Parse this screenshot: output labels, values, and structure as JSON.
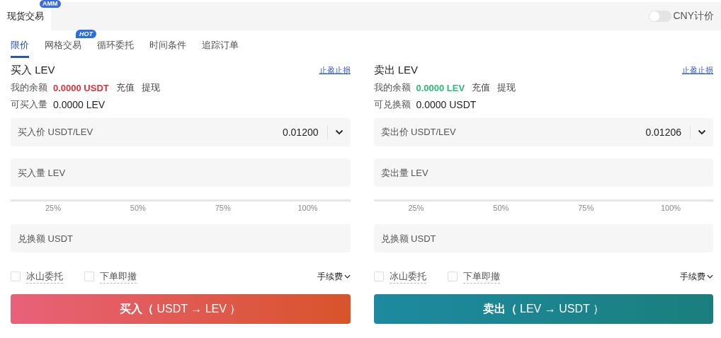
{
  "top_tabs": [
    {
      "label": "现货交易",
      "selected": true,
      "badge": "AMM"
    }
  ],
  "cny_toggle": {
    "label": "CNY计价",
    "on": false
  },
  "order_tabs": [
    {
      "label": "限价",
      "selected": true
    },
    {
      "label": "网格交易",
      "selected": false,
      "badge": "HOT"
    },
    {
      "label": "循环委托",
      "selected": false
    },
    {
      "label": "时间条件",
      "selected": false
    },
    {
      "label": "追踪订单",
      "selected": false
    }
  ],
  "panels": [
    {
      "kind": "buy",
      "title": "买入 LEV",
      "stop_link": "止盈止损",
      "balance_label": "我的余额",
      "balance_value": "0.0000 USDT",
      "deposit": "充值",
      "withdraw": "提现",
      "available_label": "可买入量",
      "available_value": "0.0000 LEV",
      "price_placeholder": "买入价 USDT/LEV",
      "price_value": "0.01200",
      "amount_placeholder": "买入量 LEV",
      "level": 0,
      "ticks": [
        "25%",
        "50%",
        "75%",
        "100%"
      ],
      "total_placeholder": "兑换额 USDT",
      "options": [
        {
          "label": "冰山委托",
          "checked": false
        },
        {
          "label": "下单即撤",
          "checked": false
        }
      ],
      "fee": "手续费",
      "button": "**买入（** USDT → LEV ）"
    },
    {
      "kind": "sell",
      "title": "卖出 LEV",
      "stop_link": "止盈止损",
      "balance_label": "我的余额",
      "balance_value": "0.0000 LEV",
      "deposit": "充值",
      "withdraw": "提现",
      "available_label": "可兑换额",
      "available_value": "0.0000 USDT",
      "price_placeholder": "卖出价 USDT/LEV",
      "price_value": "0.01206",
      "amount_placeholder": "卖出量 LEV",
      "level": 0,
      "ticks": [
        "25%",
        "50%",
        "75%",
        "100%"
      ],
      "total_placeholder": "兑换额 USDT",
      "options": [
        {
          "label": "冰山委托",
          "checked": false
        },
        {
          "label": "下单即撤",
          "checked": false
        }
      ],
      "fee": "手续费",
      "button": "**卖出（** LEV → USDT ）"
    }
  ]
}
